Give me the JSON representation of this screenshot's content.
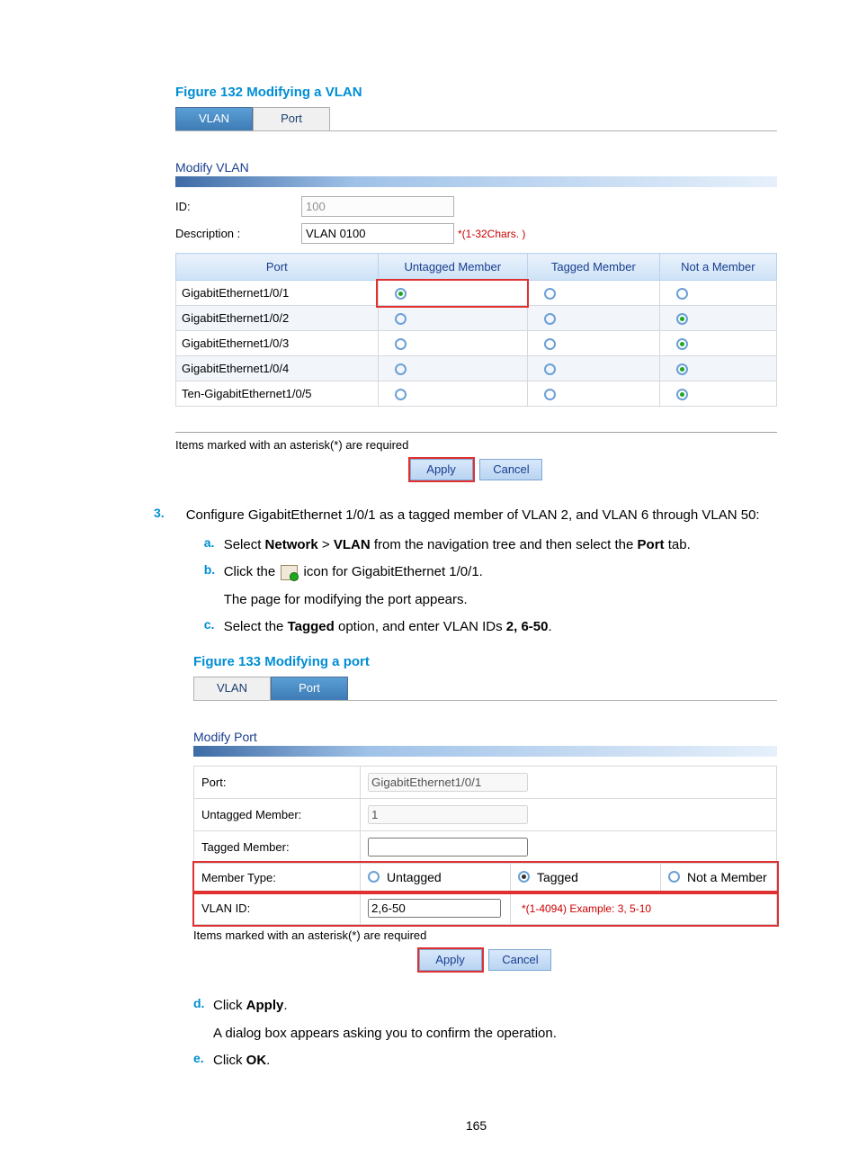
{
  "fig132": {
    "caption": "Figure 132 Modifying a VLAN",
    "tabs": {
      "active": "VLAN",
      "inactive": "Port"
    },
    "section": "Modify VLAN",
    "idLabel": "ID:",
    "idValue": "100",
    "descLabel": "Description :",
    "descValue": "VLAN 0100",
    "descHint": "*(1-32Chars. )",
    "headers": {
      "port": "Port",
      "untag": "Untagged Member",
      "tag": "Tagged Member",
      "not": "Not a Member"
    },
    "rows": [
      {
        "port": "GigabitEthernet1/0/1",
        "sel": "untag",
        "alt": false
      },
      {
        "port": "GigabitEthernet1/0/2",
        "sel": "not",
        "alt": true
      },
      {
        "port": "GigabitEthernet1/0/3",
        "sel": "not",
        "alt": false
      },
      {
        "port": "GigabitEthernet1/0/4",
        "sel": "not",
        "alt": true
      },
      {
        "port": "Ten-GigabitEthernet1/0/5",
        "sel": "not",
        "alt": false
      }
    ],
    "reqNote": "Items marked with an asterisk(*) are required",
    "applyBtn": "Apply",
    "cancelBtn": "Cancel"
  },
  "step3": {
    "num": "3.",
    "text1": "Configure GigabitEthernet 1/0/1 as a tagged member of VLAN 2, and VLAN 6 through VLAN 50:",
    "a": {
      "m": "a.",
      "pre": "Select ",
      "b1": "Network",
      "mid": " > ",
      "b2": "VLAN",
      "post": " from the navigation tree and then select the ",
      "b3": "Port",
      "post2": " tab."
    },
    "b": {
      "m": "b.",
      "pre": "Click the ",
      "post": " icon for GigabitEthernet 1/0/1.",
      "l2": "The page for modifying the port appears."
    },
    "c": {
      "m": "c.",
      "pre": "Select the ",
      "b1": "Tagged",
      "mid": " option, and enter VLAN IDs ",
      "b2": "2, 6-50",
      "post": "."
    }
  },
  "fig133": {
    "caption": "Figure 133 Modifying a port",
    "tabs": {
      "inactive": "VLAN",
      "active": "Port"
    },
    "section": "Modify Port",
    "portLabel": "Port:",
    "portValue": "GigabitEthernet1/0/1",
    "untagLabel": "Untagged Member:",
    "untagValue": "1",
    "tagLabel": "Tagged Member:",
    "tagValue": "",
    "memTypeLabel": "Member Type:",
    "radios": {
      "untag": "Untagged",
      "tag": "Tagged",
      "not": "Not a Member"
    },
    "vlanIdLabel": "VLAN ID:",
    "vlanIdValue": "2,6-50",
    "vlanHint": "*(1-4094) Example: 3, 5-10",
    "reqNote": "Items marked with an asterisk(*) are required",
    "applyBtn": "Apply",
    "cancelBtn": "Cancel"
  },
  "stepDE": {
    "d": {
      "m": "d.",
      "pre": "Click ",
      "b": "Apply",
      "post": ".",
      "l2": "A dialog box appears asking you to confirm the operation."
    },
    "e": {
      "m": "e.",
      "pre": "Click ",
      "b": "OK",
      "post": "."
    }
  },
  "pageNumber": "165"
}
